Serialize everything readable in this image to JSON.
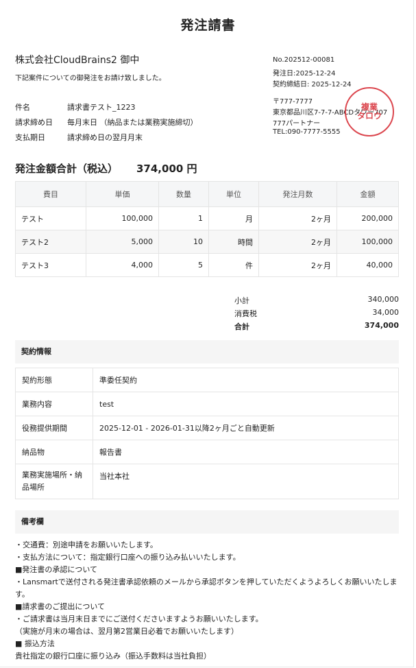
{
  "document": {
    "title": "発注請書",
    "client": "株式会社CloudBrains2 御中",
    "intro": "下記案件についての御発注をお請け致しました。"
  },
  "meta": {
    "number": "No.202512-00081",
    "order_date": "発注日:2025-12-24",
    "contract_date": "契約締結日: 2025-12-24",
    "postal": "〒777-7777",
    "address": "東京都品川区7-7-7-ABCDタワー707",
    "company": "777パートナー",
    "tel": "TEL:090-7777-5555"
  },
  "stamp": {
    "line1": "複業",
    "line2": "タロウ",
    "color": "#d9363e"
  },
  "info": [
    {
      "label": "件名",
      "value": "請求書テスト_1223"
    },
    {
      "label": "請求締め日",
      "value": "毎月末日 （納品または業務実施締切）"
    },
    {
      "label": "支払期日",
      "value": "請求締め日の翌月月末"
    }
  ],
  "total": {
    "label": "発注金額合計（税込）",
    "value": "374,000 円"
  },
  "items_table": {
    "headers": [
      "費目",
      "単価",
      "数量",
      "単位",
      "発注月数",
      "金額"
    ],
    "rows": [
      [
        "テスト",
        "100,000",
        "1",
        "月",
        "2ヶ月",
        "200,000"
      ],
      [
        "テスト2",
        "5,000",
        "10",
        "時間",
        "2ヶ月",
        "100,000"
      ],
      [
        "テスト3",
        "4,000",
        "5",
        "件",
        "2ヶ月",
        "40,000"
      ]
    ]
  },
  "summary": {
    "subtotal_label": "小計",
    "subtotal": "340,000",
    "tax_label": "消費税",
    "tax": "34,000",
    "total_label": "合計",
    "total": "374,000"
  },
  "contract": {
    "heading": "契約情報",
    "rows": [
      {
        "key": "契約形態",
        "value": "準委任契約"
      },
      {
        "key": "業務内容",
        "value": "test"
      },
      {
        "key": "役務提供期間",
        "value": "2025-12-01 - 2026-01-31以降2ヶ月ごと自動更新"
      },
      {
        "key": "納品物",
        "value": "報告書"
      },
      {
        "key": "業務実施場所・納品場所",
        "value": "当社本社"
      }
    ]
  },
  "remarks": {
    "heading": "備考欄",
    "lines": [
      "・交通費：別途申請をお願いいたします。",
      "・支払方法について：指定銀行口座への振り込み払いいたします。",
      "■発注書の承認について",
      "・Lansmartで送付される発注書承認依頼のメールから承認ボタンを押していただくようよろしくお願いいたします。",
      "■請求書のご提出について",
      "・ご請求書は当月末日までにご送付くださいますようお願いいたします。",
      "（実施が月末の場合は、翌月第2営業日必着でお願いいたします）",
      "■ 振込方法",
      "貴社指定の銀行口座に振り込み（振込手数料は当社負担）"
    ]
  }
}
